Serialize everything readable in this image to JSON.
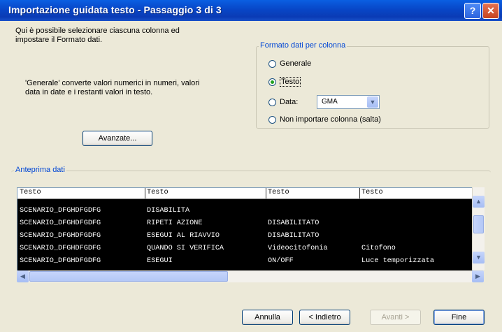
{
  "window": {
    "title": "Importazione guidata testo - Passaggio 3 di 3",
    "help_label": "?",
    "close_label": "✕"
  },
  "intro": {
    "line1": "Qui è possibile selezionare ciascuna colonna ed",
    "line2": "impostare il Formato dati.",
    "desc1": "'Generale' converte valori numerici in numeri, valori",
    "desc2": "data in date e i restanti valori in testo."
  },
  "advanced_button": "Avanzate...",
  "format_group": {
    "label": "Formato dati per colonna",
    "options": [
      "Generale",
      "Testo",
      "Data:",
      "Non importare colonna (salta)"
    ],
    "selected": "Testo",
    "date_format": "GMA"
  },
  "preview": {
    "label": "Anteprima dati",
    "headers": [
      "Testo",
      "Testo",
      "Testo",
      "Testo"
    ],
    "rows": [
      [
        "SCENARIO_DFGHDFGDFG",
        "DISABILITA",
        "",
        ""
      ],
      [
        "SCENARIO_DFGHDFGDFG",
        "RIPETI AZIONE",
        "DISABILITATO",
        ""
      ],
      [
        "SCENARIO_DFGHDFGDFG",
        "ESEGUI AL RIAVVIO",
        "DISABILITATO",
        ""
      ],
      [
        "SCENARIO_DFGHDFGDFG",
        "QUANDO SI VERIFICA",
        "Videocitofonia",
        "Citofono"
      ],
      [
        "SCENARIO_DFGHDFGDFG",
        "ESEGUI",
        "ON/OFF",
        "Luce temporizzata"
      ]
    ]
  },
  "footer": {
    "cancel": "Annulla",
    "back": "< Indietro",
    "next": "Avanti >",
    "finish": "Fine"
  },
  "colors": {
    "titlebar": "#0a46c7",
    "group_label": "#0046d5",
    "face": "#ece9d8"
  }
}
